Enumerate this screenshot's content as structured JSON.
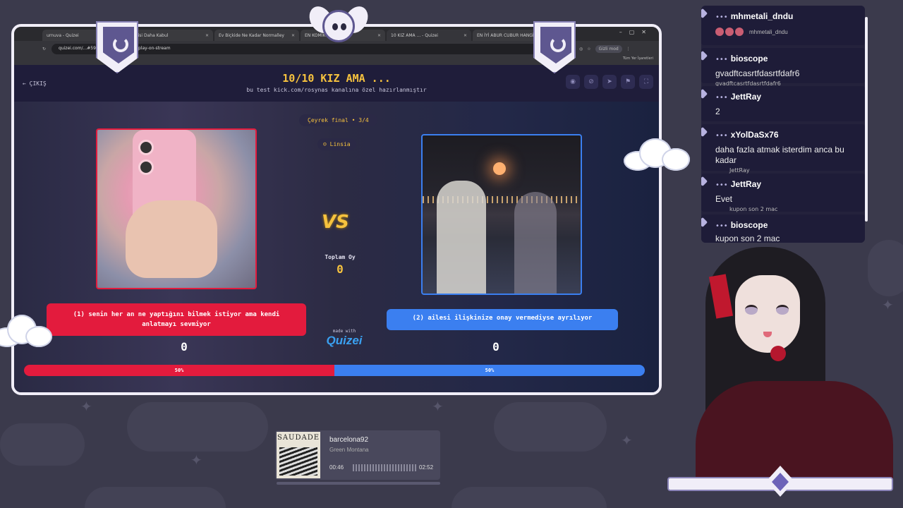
{
  "browser": {
    "tabs": [
      {
        "label": "urnuva - Quizei",
        "active": false
      },
      {
        "label": "ngisi Daha Kabul",
        "active": false
      },
      {
        "label": "Ev Biçkide Ne Kadar Normalley",
        "active": false
      },
      {
        "label": "EN KOMİK KEDİ",
        "active": false
      },
      {
        "label": "10 KIZ AMA ... - Quizei",
        "active": true
      },
      {
        "label": "EN İYİ ABUR CUBUR HANGİSİ?",
        "active": false
      }
    ],
    "new_tab": "+",
    "url": "quizei.com/...#599e32f6c4a3c8596d/play-on-stream",
    "guest_mode": "Gizli mod",
    "bookmarks": "Tüm Yer İşaretleri"
  },
  "quiz": {
    "exit_label": "ÇIKIŞ",
    "title": "10/10 KIZ AMA ...",
    "subtitle": "bu test kick.com/rosynas kanalına özel hazırlanmıştır",
    "round": "Çeyrek final • 3/4",
    "player": "Linsia",
    "vs": "VS",
    "total_label": "Toplam Oy",
    "total_value": "0",
    "made_with": "made with",
    "brand": "Quizei",
    "left": {
      "option": "(1) senin her an ne yaptığını bilmek istiyor ama kendi anlatmayı sevmiyor",
      "votes": "0",
      "percent_label": "50%",
      "percent": 50,
      "color": "#e31b3d"
    },
    "right": {
      "option": "(2) ailesi ilişkinize onay vermediyse ayrılıyor",
      "votes": "0",
      "percent_label": "50%",
      "percent": 50,
      "color": "#3b7ff0"
    }
  },
  "chat": {
    "messages": [
      {
        "user": "mhmetali_dndu",
        "text": "",
        "ghost": "mhmetali_dndu"
      },
      {
        "user": "bioscope",
        "text": "gvadftcasrtfdasrtfdafr6",
        "ghost": "gvadftcasrtfdasrtfdafr6"
      },
      {
        "user": "JettRay",
        "text": "2",
        "ghost": ""
      },
      {
        "user": "xYolDaSx76",
        "text": "daha fazla atmak isterdim anca bu kadar",
        "ghost": "JettRay"
      },
      {
        "user": "JettRay",
        "text": "Evet",
        "ghost": "kupon son 2 mac"
      },
      {
        "user": "bioscope",
        "text": "kupon son 2 mac",
        "ghost": ""
      }
    ]
  },
  "music": {
    "album": "SAUDADE",
    "song": "barcelona92",
    "artist": "Green Montana",
    "elapsed": "00:46",
    "duration": "02:52"
  }
}
